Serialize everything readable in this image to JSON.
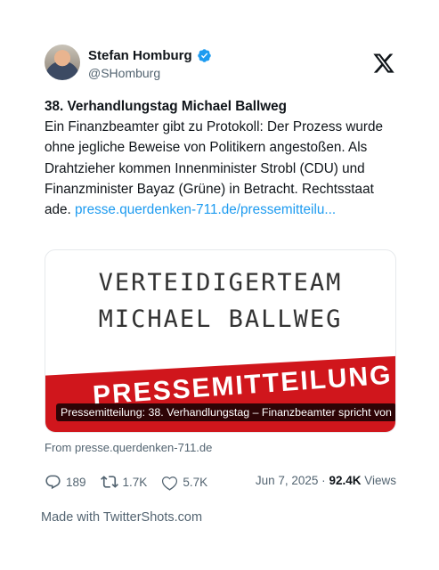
{
  "author": {
    "display_name": "Stefan Homburg",
    "handle": "@SHomburg",
    "verified_icon": "verified-badge-icon"
  },
  "brand": {
    "logo": "x-logo-icon"
  },
  "tweet": {
    "title": "38. Verhandlungstag Michael Ballweg",
    "body": "Ein Finanzbeamter gibt zu Protokoll: Der Prozess wurde ohne jegliche Beweise von Politikern angestoßen. Als Drahtzieher kommen Innenminister Strobl (CDU) und Finanzminister Bayaz (Grüne) in Betracht. Rechtsstaat ade. ",
    "link": "presse.querdenken-711.de/pressemitteilu..."
  },
  "media": {
    "line1": "VERTEIDIGERTEAM",
    "line2": "MICHAEL BALLWEG",
    "band_text": "PRESSEMITTEILUNG",
    "caption": "Pressemitteilung: 38. Verhandlungstag – Finanzbeamter spricht von",
    "band_color": "#d0161c"
  },
  "source": "From presse.querdenken-711.de",
  "metrics": {
    "replies": "189",
    "reposts": "1.7K",
    "likes": "5.7K",
    "date": "Jun 7, 2025 · ",
    "views_count": "92.4K",
    "views_label": " Views"
  },
  "footer": {
    "made_with": "Made with TwitterShots.com"
  },
  "colors": {
    "link": "#1d9bf0",
    "verified": "#1d9bf0",
    "muted": "#536471"
  }
}
